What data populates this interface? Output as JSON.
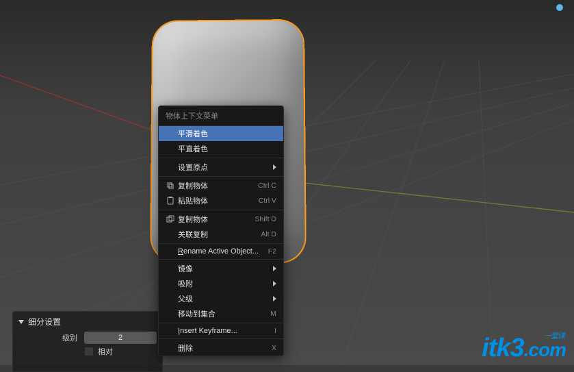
{
  "viewport": {
    "preset_indicator": "●"
  },
  "context_menu": {
    "title": "物体上下文菜单",
    "items": [
      {
        "label": "平滑着色",
        "highlighted": true
      },
      {
        "label": "平直着色"
      },
      {
        "sep": true
      },
      {
        "label": "设置原点",
        "submenu": true
      },
      {
        "sep": true
      },
      {
        "label": "复制物体",
        "shortcut": "Ctrl C",
        "icon": "copy"
      },
      {
        "label": "粘贴物体",
        "shortcut": "Ctrl V",
        "icon": "paste"
      },
      {
        "sep": true
      },
      {
        "label": "复制物体",
        "shortcut": "Shift D",
        "icon": "duplicate"
      },
      {
        "label": "关联复制",
        "shortcut": "Alt D"
      },
      {
        "sep": true
      },
      {
        "label": "Rename Active Object...",
        "shortcut": "F2",
        "underline_first": true
      },
      {
        "sep": true
      },
      {
        "label": "镜像",
        "submenu": true
      },
      {
        "label": "吸附",
        "submenu": true
      },
      {
        "label": "父级",
        "submenu": true
      },
      {
        "label": "移动到集合",
        "shortcut": "M"
      },
      {
        "sep": true
      },
      {
        "label": "Insert Keyframe...",
        "shortcut": "I",
        "underline_first": true
      },
      {
        "sep": true
      },
      {
        "label": "删除",
        "shortcut": "X"
      }
    ]
  },
  "operator_panel": {
    "title": "细分设置",
    "level_label": "级别",
    "level_value": "2",
    "relative_label": "相对"
  },
  "logo": {
    "brand": "itk3",
    "domain": ".com",
    "tagline": "一堂课"
  }
}
